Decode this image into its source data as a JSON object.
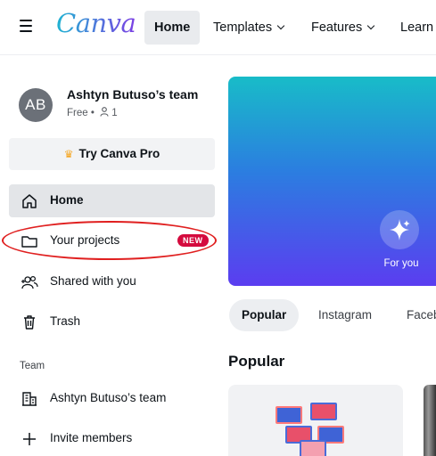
{
  "topbar": {
    "logo_text": "Canva",
    "nav": [
      {
        "label": "Home"
      },
      {
        "label": "Templates"
      },
      {
        "label": "Features"
      },
      {
        "label": "Learn"
      }
    ]
  },
  "sidebar": {
    "avatar_initials": "AB",
    "team_name": "Ashtyn Butuso’s team",
    "plan": "Free •",
    "member_count": "1",
    "pro_button": "Try Canva Pro",
    "items": [
      {
        "label": "Home",
        "icon": "home-icon"
      },
      {
        "label": "Your projects",
        "icon": "folder-icon",
        "badge": "NEW"
      },
      {
        "label": "Shared with you",
        "icon": "people-icon"
      },
      {
        "label": "Trash",
        "icon": "trash-icon"
      }
    ],
    "team_section_label": "Team",
    "team_items": [
      {
        "label": "Ashtyn Butuso’s team",
        "icon": "building-icon"
      },
      {
        "label": "Invite members",
        "icon": "plus-icon"
      }
    ]
  },
  "main": {
    "hero_button_label": "For you",
    "chips": [
      {
        "label": "Popular"
      },
      {
        "label": "Instagram"
      },
      {
        "label": "Faceb"
      }
    ],
    "section_title": "Popular"
  },
  "colors": {
    "accent_red": "#d40b3e",
    "annotation_red": "#e02020",
    "hero_gradient_top": "#18bcc8",
    "hero_gradient_bottom": "#5b3df0"
  }
}
